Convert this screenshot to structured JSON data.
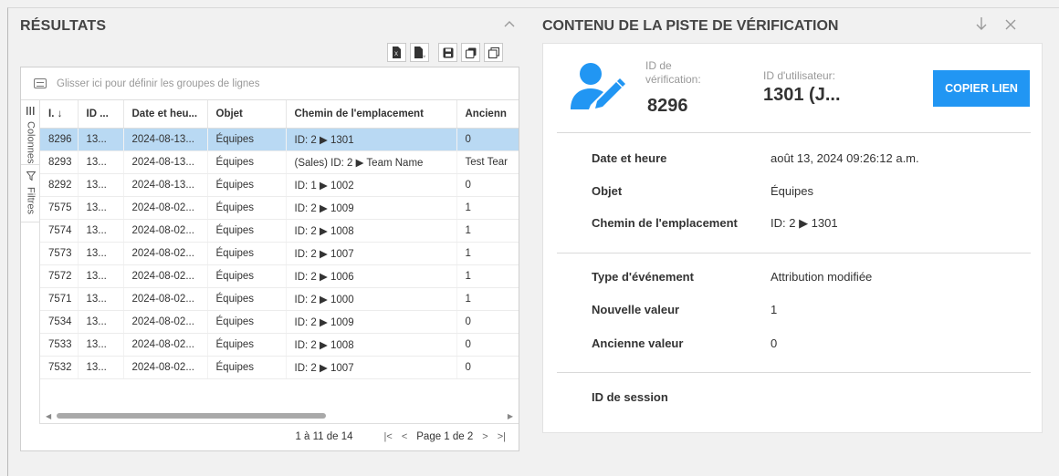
{
  "results": {
    "title": "RÉSULTATS",
    "group_placeholder": "Glisser ici pour définir les groupes de lignes",
    "side_tabs": {
      "columns": "Colonnes",
      "filters": "Filtres"
    },
    "columns": [
      "I. ↓",
      "ID ...",
      "Date et heu...",
      "Objet",
      "Chemin de l'emplacement",
      "Ancienn"
    ],
    "rows": [
      [
        "8296",
        "13...",
        "2024-08-13...",
        "Équipes",
        "ID: 2 ▶ 1301",
        "0"
      ],
      [
        "8293",
        "13...",
        "2024-08-13...",
        "Équipes",
        "(Sales) ID: 2 ▶ Team Name",
        "Test Tear"
      ],
      [
        "8292",
        "13...",
        "2024-08-13...",
        "Équipes",
        "ID: 1 ▶ 1002",
        "0"
      ],
      [
        "7575",
        "13...",
        "2024-08-02...",
        "Équipes",
        "ID: 2 ▶ 1009",
        "1"
      ],
      [
        "7574",
        "13...",
        "2024-08-02...",
        "Équipes",
        "ID: 2 ▶ 1008",
        "1"
      ],
      [
        "7573",
        "13...",
        "2024-08-02...",
        "Équipes",
        "ID: 2 ▶ 1007",
        "1"
      ],
      [
        "7572",
        "13...",
        "2024-08-02...",
        "Équipes",
        "ID: 2 ▶ 1006",
        "1"
      ],
      [
        "7571",
        "13...",
        "2024-08-02...",
        "Équipes",
        "ID: 2 ▶ 1000",
        "1"
      ],
      [
        "7534",
        "13...",
        "2024-08-02...",
        "Équipes",
        "ID: 2 ▶ 1009",
        "0"
      ],
      [
        "7533",
        "13...",
        "2024-08-02...",
        "Équipes",
        "ID: 2 ▶ 1008",
        "0"
      ],
      [
        "7532",
        "13...",
        "2024-08-02...",
        "Équipes",
        "ID: 2 ▶ 1007",
        "0"
      ]
    ],
    "selected_row": 0,
    "pager": {
      "range": "1 à 11 de 14",
      "page": "Page 1 de 2"
    }
  },
  "detail": {
    "title": "CONTENU DE LA PISTE DE VÉRIFICATION",
    "verification_id_label": "ID de vérification:",
    "verification_id": "8296",
    "user_id_label": "ID d'utilisateur:",
    "user_id": "1301 (J...",
    "copy_button": "COPIER LIEN",
    "fields": [
      {
        "label": "Date et heure",
        "value": "août 13, 2024 09:26:12 a.m."
      },
      {
        "label": "Objet",
        "value": "Équipes"
      },
      {
        "label": "Chemin de l'emplacement",
        "value": "ID: 2 ▶ 1301"
      },
      {
        "label": "Type d'événement",
        "value": "Attribution modifiée"
      },
      {
        "label": "Nouvelle valeur",
        "value": "1"
      },
      {
        "label": "Ancienne valeur",
        "value": "0"
      },
      {
        "label": "ID de session",
        "value": ""
      }
    ],
    "accent_color": "#2196f3"
  }
}
